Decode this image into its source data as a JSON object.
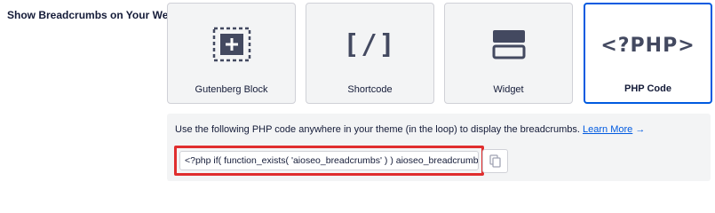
{
  "setting": {
    "label": "Show Breadcrumbs on Your Website"
  },
  "options": [
    {
      "label": "Gutenberg Block",
      "icon": "gutenberg-block-icon",
      "selected": false
    },
    {
      "label": "Shortcode",
      "icon": "shortcode-icon",
      "icon_text": "[/]",
      "selected": false
    },
    {
      "label": "Widget",
      "icon": "widget-icon",
      "selected": false
    },
    {
      "label": "PHP Code",
      "icon": "php-code-icon",
      "icon_text": "<?PHP>",
      "selected": true
    }
  ],
  "instructions": {
    "text": "Use the following PHP code anywhere in your theme (in the loop) to display the breadcrumbs.",
    "link_label": "Learn More",
    "link_arrow": "→"
  },
  "code": {
    "value": "<?php if( function_exists( 'aioseo_breadcrumbs' ) ) aioseo_breadcrumbs(); ?>"
  },
  "copy_button": {
    "icon": "copy-icon"
  },
  "colors": {
    "accent": "#005ae0",
    "highlight": "#e02e2e",
    "text": "#141b38",
    "card_bg": "#f3f4f5",
    "icon": "#434960"
  }
}
